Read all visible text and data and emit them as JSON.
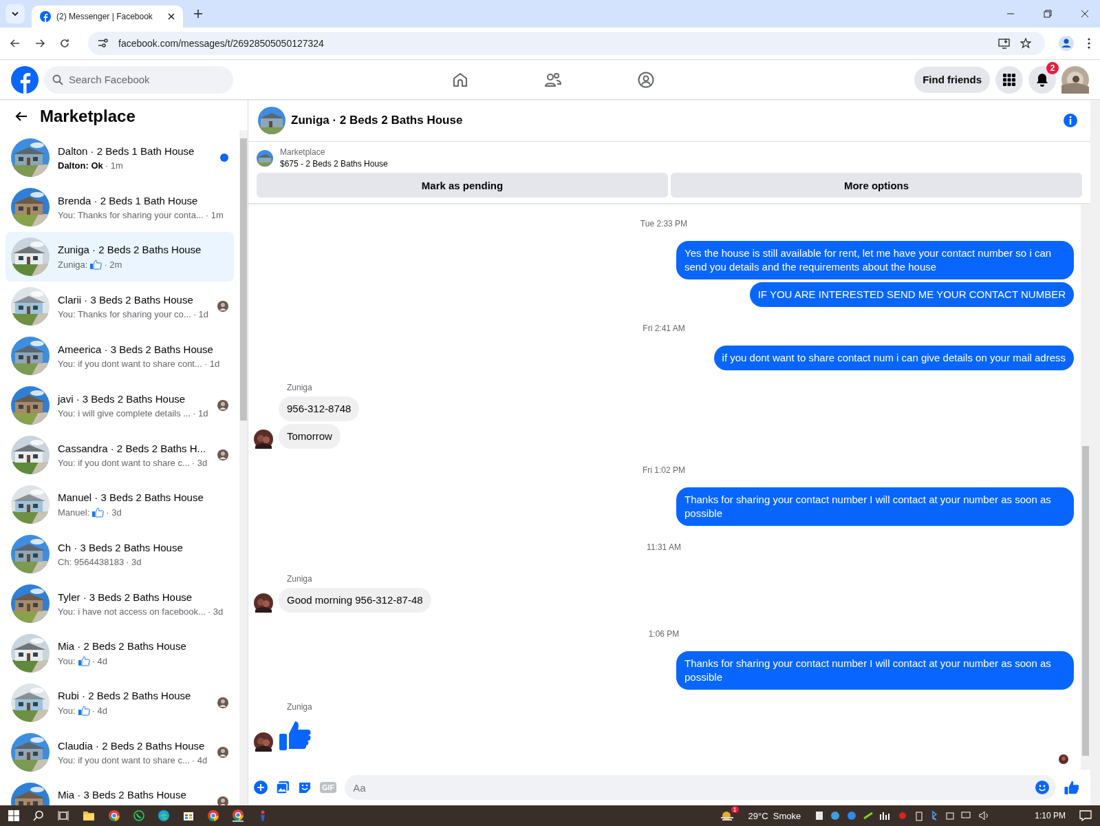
{
  "browser": {
    "tab_title": "(2) Messenger | Facebook",
    "url": "facebook.com/messages/t/26928505050127324"
  },
  "header": {
    "search": {
      "placeholder": "Search Facebook"
    },
    "find_friends": "Find friends",
    "notification_count": "2"
  },
  "sidebar": {
    "title": "Marketplace",
    "items": [
      {
        "title": "Dalton · 2 Beds 1 Bath House",
        "preview": "Dalton: Ok",
        "like": false,
        "time": "· 1m",
        "unread": true,
        "seen": false,
        "selected": false
      },
      {
        "title": "Brenda · 2 Beds 1 Bath House",
        "preview": "You: Thanks for sharing your conta...",
        "like": false,
        "time": "· 1m",
        "unread": false,
        "seen": false,
        "selected": false
      },
      {
        "title": "Zuniga · 2 Beds 2 Baths House",
        "preview": "Zuniga:",
        "like": true,
        "time": "· 2m",
        "unread": false,
        "seen": false,
        "selected": true
      },
      {
        "title": "Clarii · 3 Beds 2 Baths House",
        "preview": "You: Thanks for sharing your co...",
        "like": false,
        "time": "· 1d",
        "unread": false,
        "seen": true,
        "selected": false
      },
      {
        "title": "Ameerica · 3 Beds 2 Baths House",
        "preview": "You: if you dont want to share cont...",
        "like": false,
        "time": "· 1d",
        "unread": false,
        "seen": false,
        "selected": false
      },
      {
        "title": "javi · 3 Beds 2 Baths House",
        "preview": "You: i will give complete details ...",
        "like": false,
        "time": "· 1d",
        "unread": false,
        "seen": true,
        "selected": false
      },
      {
        "title": "Cassandra · 2 Beds 2 Baths H...",
        "preview": "You: if you dont want to share c...",
        "like": false,
        "time": "· 3d",
        "unread": false,
        "seen": true,
        "selected": false
      },
      {
        "title": "Manuel · 3 Beds 2 Baths House",
        "preview": "Manuel:",
        "like": true,
        "time": "· 3d",
        "unread": false,
        "seen": false,
        "selected": false
      },
      {
        "title": "Ch · 3 Beds 2 Baths House",
        "preview": "Ch: 9564438183",
        "like": false,
        "time": "· 3d",
        "unread": false,
        "seen": false,
        "selected": false
      },
      {
        "title": "Tyler · 3 Beds 2 Baths House",
        "preview": "You: i have not access on facebook...",
        "like": false,
        "time": "· 3d",
        "unread": false,
        "seen": false,
        "selected": false
      },
      {
        "title": "Mia · 2 Beds 2 Baths House",
        "preview": "You:",
        "like": true,
        "time": "· 4d",
        "unread": false,
        "seen": false,
        "selected": false
      },
      {
        "title": "Rubi · 2 Beds 2 Baths House",
        "preview": "You:",
        "like": true,
        "time": "· 4d",
        "unread": false,
        "seen": true,
        "selected": false
      },
      {
        "title": "Claudia · 2 Beds 2 Baths House",
        "preview": "You: if you dont want to share c...",
        "like": false,
        "time": "· 4d",
        "unread": false,
        "seen": true,
        "selected": false
      },
      {
        "title": "Mia · 3 Beds 2 Baths House",
        "unread": false,
        "seen": true,
        "selected": false
      }
    ]
  },
  "chat": {
    "title": "Zuniga · 2 Beds 2 Baths House",
    "listing": {
      "source": "Marketplace",
      "price_title": "$675 - 2 Beds 2 Baths House",
      "buttons": [
        "Mark as pending",
        "More options"
      ]
    },
    "messages": [
      {
        "kind": "time",
        "text": "Tue 2:33 PM"
      },
      {
        "kind": "sent",
        "text": "Yes the house is still available for rent, let me have your contact number so i can send you details and the requirements about the house"
      },
      {
        "kind": "sent",
        "text": "IF YOU ARE INTERESTED SEND ME YOUR CONTACT NUMBER"
      },
      {
        "kind": "time",
        "text": "Fri 2:41 AM"
      },
      {
        "kind": "sent",
        "text": "if you dont want to share contact num i can give details on your mail adress"
      },
      {
        "kind": "received",
        "sender": "Zuniga",
        "text": "956-312-8748",
        "avatar": false
      },
      {
        "kind": "received",
        "text": "Tomorrow",
        "avatar": true
      },
      {
        "kind": "time",
        "text": "Fri 1:02 PM"
      },
      {
        "kind": "sent",
        "text": "Thanks for sharing your contact number I will contact at your number as soon as possible"
      },
      {
        "kind": "time",
        "text": "11:31 AM"
      },
      {
        "kind": "received",
        "sender": "Zuniga",
        "text": "Good morning 956-312-87-48",
        "avatar": true
      },
      {
        "kind": "time",
        "text": "1:06 PM"
      },
      {
        "kind": "sent",
        "text": "Thanks for sharing your contact number I will contact at your number as soon as possible"
      },
      {
        "kind": "like",
        "sender": "Zuniga",
        "avatar": true
      },
      {
        "kind": "seen"
      }
    ],
    "composer": {
      "gif_label": "GIF",
      "placeholder": "Aa"
    }
  },
  "taskbar": {
    "weather_badge": "1",
    "weather": "29°C  Smoke",
    "clock": "1:10 PM"
  }
}
